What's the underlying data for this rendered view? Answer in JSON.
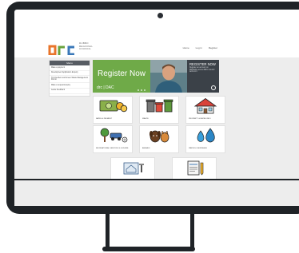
{
  "site": {
    "logo_lines": [
      "DUBBO",
      "REGIONAL",
      "COUNCIL"
    ],
    "nav": [
      "Home",
      "Log in",
      "Register"
    ]
  },
  "menu": {
    "title": "Menu",
    "items": [
      "Make a payment",
      "Development Application Enquiry",
      "Tip Vouchers and Green Waste Management Permit",
      "Make a request/enquiry",
      "Leave Feedback"
    ]
  },
  "banner": {
    "title": "Register Now",
    "side_title": "REGISTER NOW",
    "side_text": "Register an account on DRMSAK and let DRC Council work on it"
  },
  "tiles": [
    {
      "label": "Rates & Payment",
      "icon": "money-icon"
    },
    {
      "label": "Waste",
      "icon": "waste-bins-icon"
    },
    {
      "label": "Property & Rates Info",
      "icon": "house-icon"
    },
    {
      "label": "Recreational Services & Leisure",
      "icon": "recreation-icon"
    },
    {
      "label": "Animals",
      "icon": "pets-icon"
    },
    {
      "label": "Water & Sewerage",
      "icon": "water-drops-icon"
    },
    {
      "label": "",
      "icon": "building-plan-icon"
    },
    {
      "label": "",
      "icon": "forms-icon"
    }
  ],
  "colors": {
    "bezel": "#1f2327",
    "banner_green": "#6faa48",
    "banner_dark": "#3b4148",
    "menu_header": "#575c63",
    "logo_orange": "#e8742a"
  }
}
